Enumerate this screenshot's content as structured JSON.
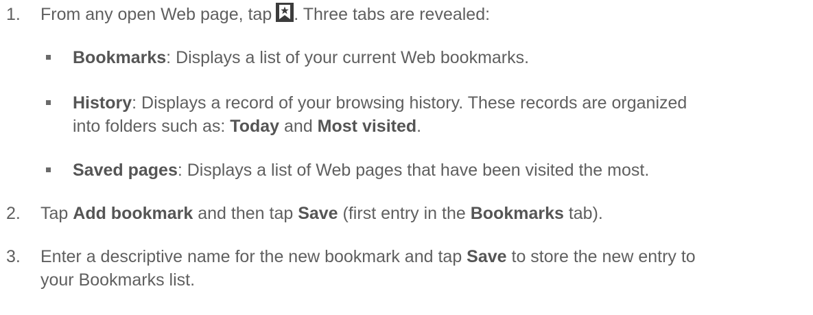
{
  "steps": [
    {
      "number": "1.",
      "text_before_icon": "From any open Web page, tap",
      "text_after_icon": ". Three tabs are revealed:",
      "icon": "bookmark-star-icon",
      "bullets": [
        {
          "term": "Bookmarks",
          "text": ": Displays a list of your current Web bookmarks."
        },
        {
          "term": "History",
          "text": ": Displays a record of your browsing history. These records are organized",
          "line2_a": "into folders such as: ",
          "line2_term1": "Today",
          "line2_b": " and ",
          "line2_term2": "Most visited",
          "line2_c": "."
        },
        {
          "term": "Saved pages",
          "text": ": Displays a list of Web pages that have been visited the most."
        }
      ]
    },
    {
      "number": "2.",
      "a": "Tap ",
      "term1": "Add bookmark",
      "b": " and then tap ",
      "term2": "Save",
      "c": " (first entry in the ",
      "term3": "Bookmarks",
      "d": " tab)."
    },
    {
      "number": "3.",
      "a": "Enter a descriptive name for the new bookmark and tap ",
      "term1": "Save",
      "b": " to store the new entry to",
      "line2": "your Bookmarks list."
    }
  ],
  "colors": {
    "text": "#5f5f5f",
    "bold": "#555555",
    "icon_bg": "#3c3c3c"
  }
}
